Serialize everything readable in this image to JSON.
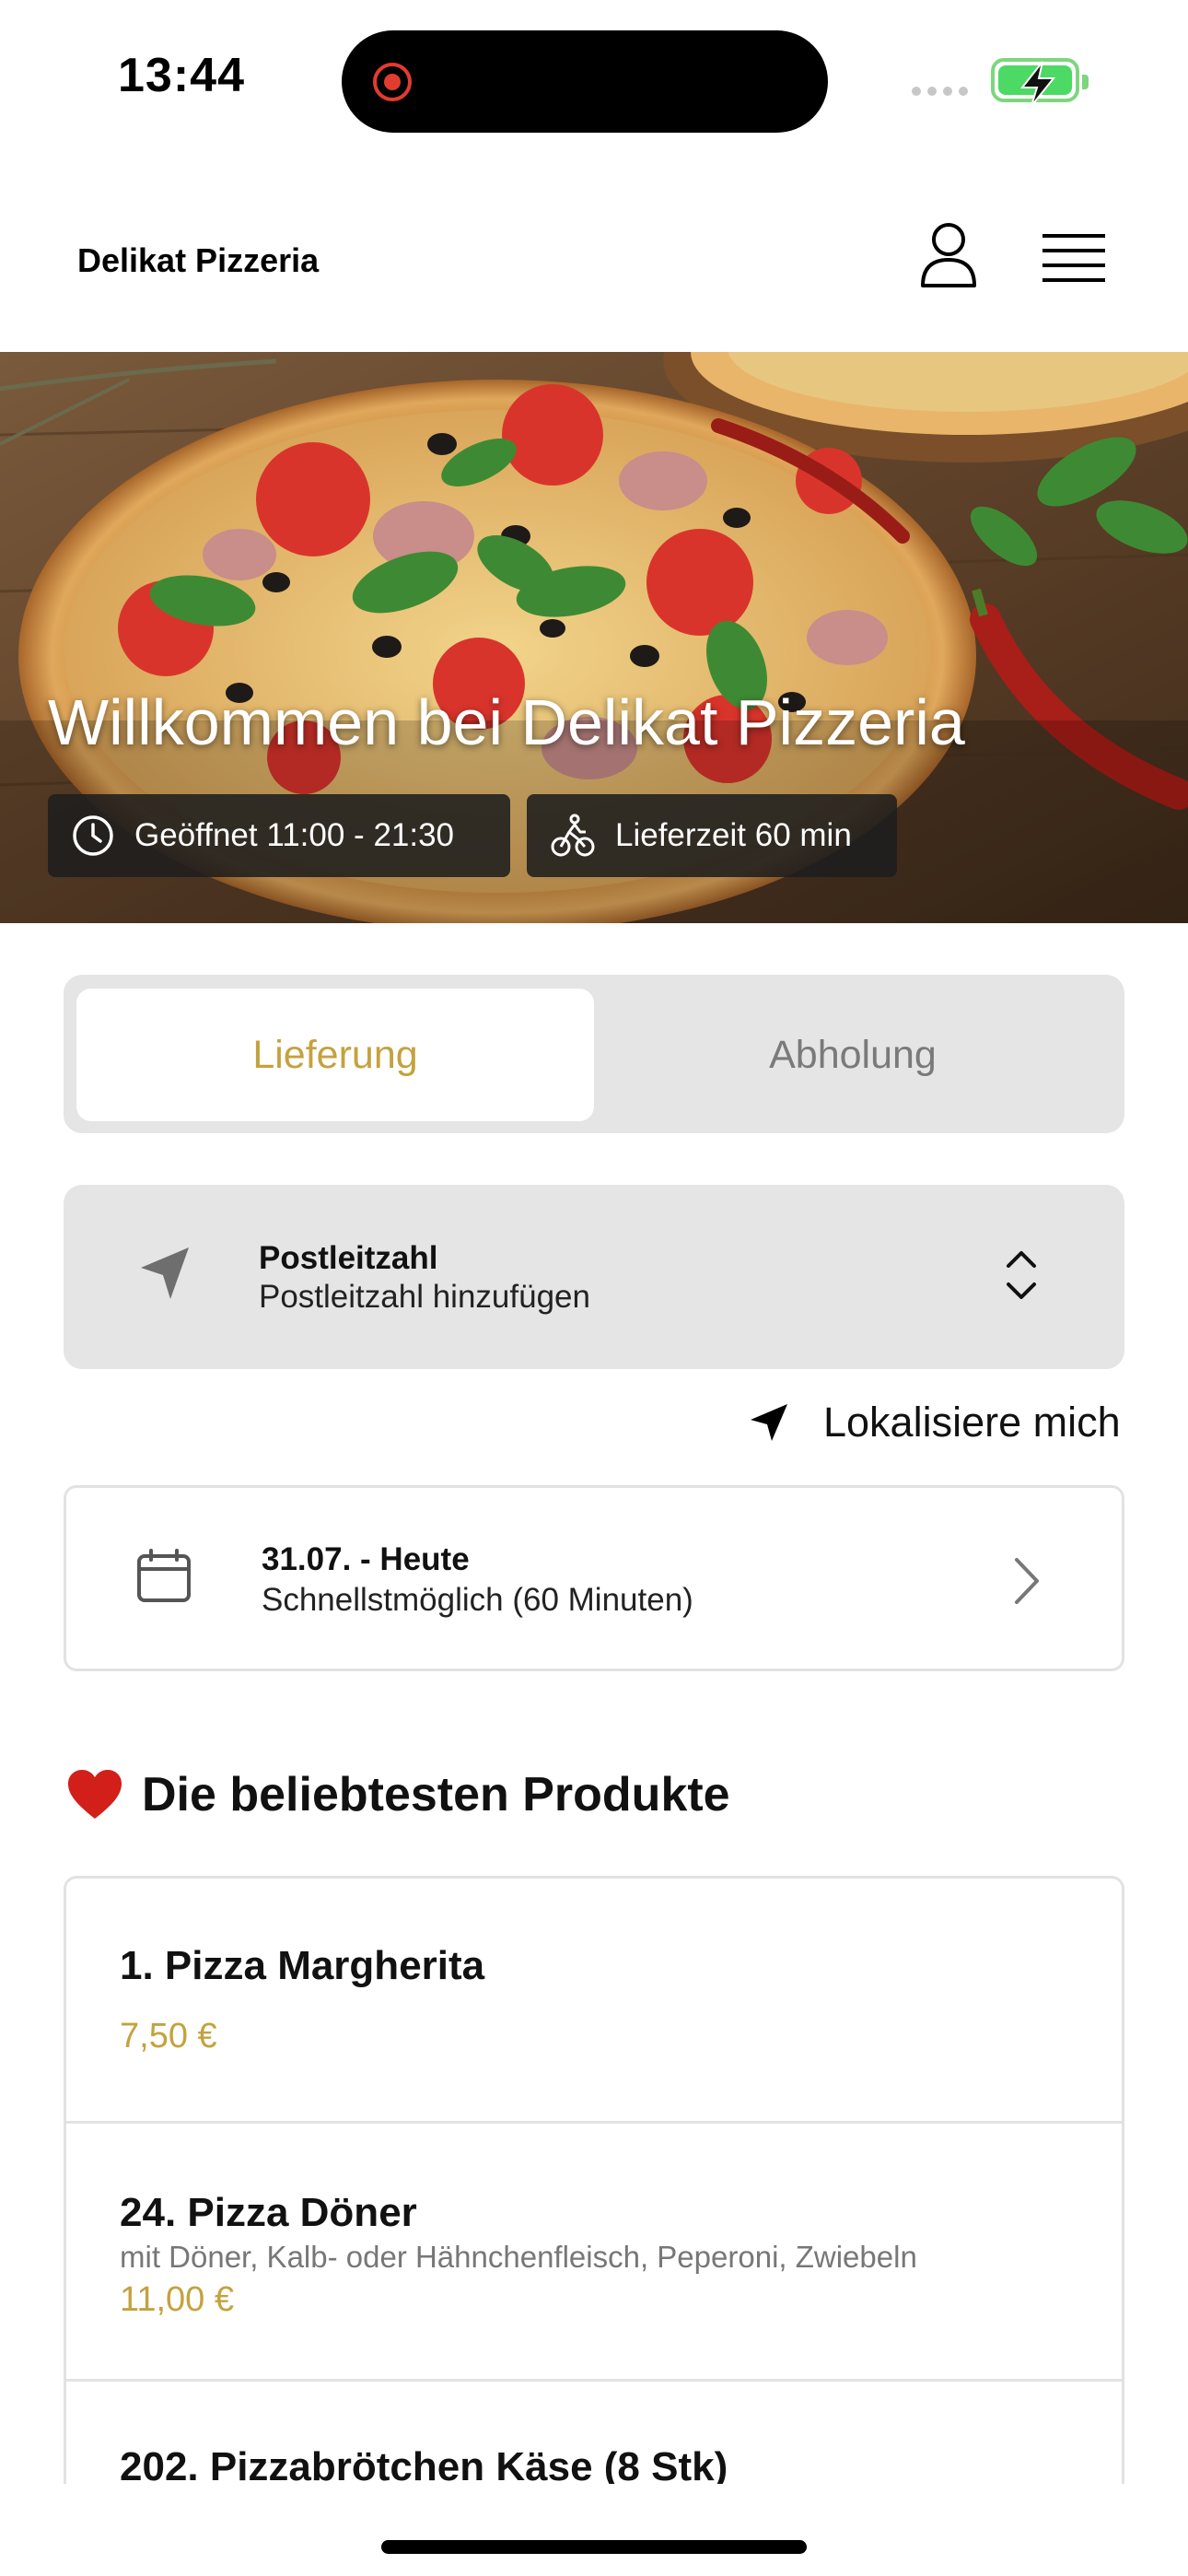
{
  "status_bar": {
    "time": "13:44"
  },
  "header": {
    "brand": "Delikat Pizzeria"
  },
  "hero": {
    "title": "Willkommen bei Delikat Pizzeria",
    "opening_hours": "Geöffnet 11:00 - 21:30",
    "delivery_time": "Lieferzeit 60 min"
  },
  "mode_toggle": {
    "delivery_label": "Lieferung",
    "pickup_label": "Abholung",
    "selected": "Lieferung"
  },
  "postal": {
    "label": "Postleitzahl",
    "placeholder": "Postleitzahl hinzufügen"
  },
  "locate": {
    "label": "Lokalisiere mich"
  },
  "date": {
    "label": "31.07. - Heute",
    "value": "Schnellstmöglich (60 Minuten)"
  },
  "popular": {
    "title": "Die beliebtesten Produkte",
    "products": [
      {
        "name": "1. Pizza Margherita",
        "description": "",
        "price": "7,50 €"
      },
      {
        "name": "24. Pizza Döner",
        "description": "mit Döner, Kalb- oder Hähnchenfleisch, Peperoni, Zwiebeln",
        "price": "11,00 €"
      },
      {
        "name": "202. Pizzabrötchen Käse (8 Stk)",
        "description": "",
        "price": ""
      }
    ]
  },
  "colors": {
    "accent": "#c4a23e",
    "panel": "#e5e5e5",
    "border": "#e2e2e2"
  }
}
